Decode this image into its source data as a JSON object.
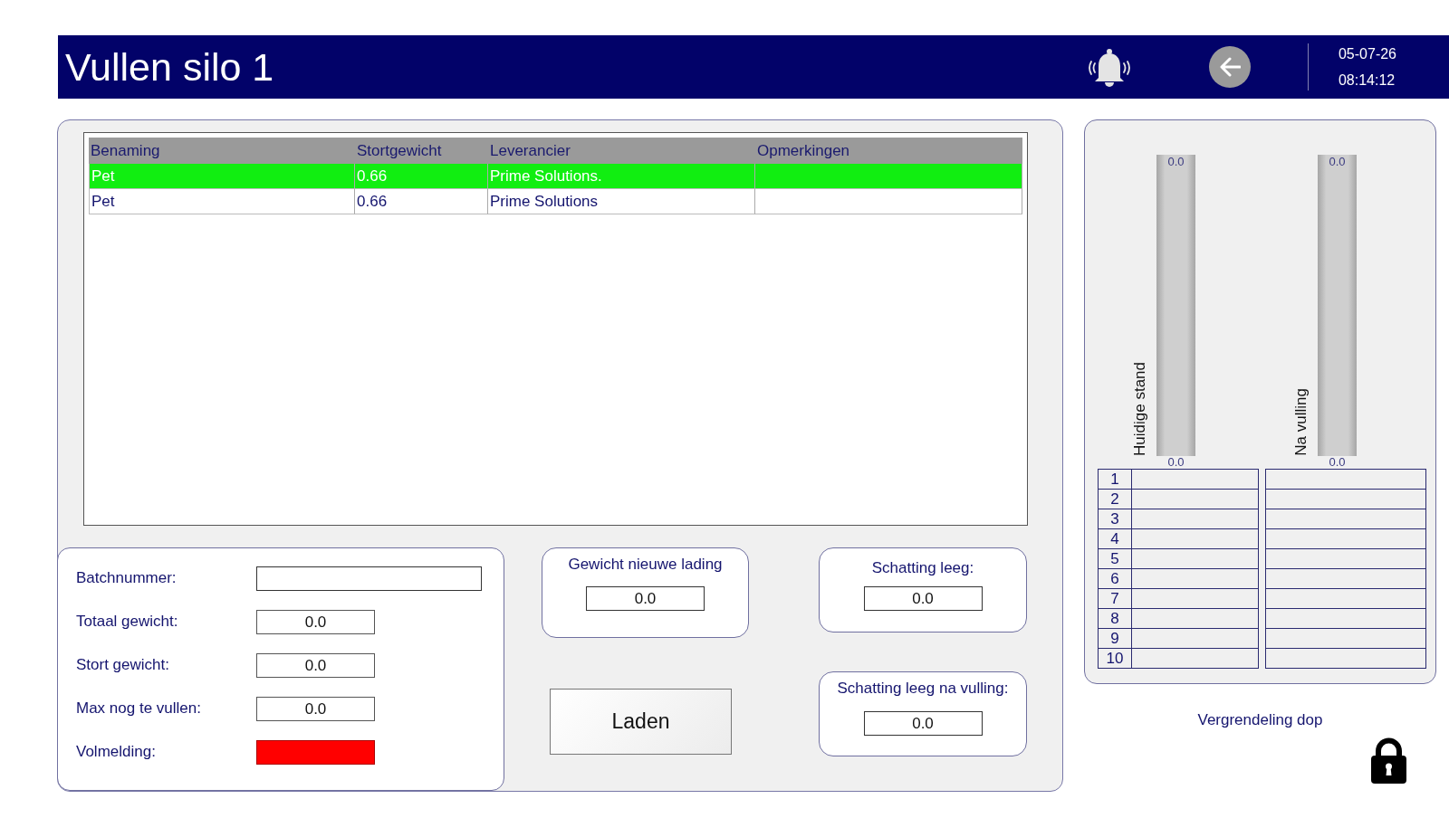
{
  "header": {
    "title": "Vullen silo 1",
    "date": "05-07-26",
    "time": "08:14:12"
  },
  "materials_table": {
    "columns": [
      "Benaming",
      "Stortgewicht",
      "Leverancier",
      "Opmerkingen"
    ],
    "rows": [
      {
        "cells": [
          "Pet",
          "0.66",
          "Prime Solutions."
        ],
        "selected": true
      },
      {
        "cells": [
          "Pet",
          "0.66",
          "Prime Solutions"
        ],
        "selected": false
      }
    ]
  },
  "batch_form": {
    "fields": [
      {
        "kind": "text",
        "label": "Batchnummer:"
      },
      {
        "kind": "number",
        "label": "Totaal gewicht:",
        "value": "0.0"
      },
      {
        "kind": "number",
        "label": "Stort gewicht:",
        "value": "0.0"
      },
      {
        "kind": "number",
        "label": "Max nog te vullen:",
        "value": "0.0"
      },
      {
        "kind": "indicator",
        "label": "Volmelding:",
        "on": true
      }
    ]
  },
  "load_weight": {
    "label": "Gewicht nieuwe lading",
    "value": "0.0"
  },
  "load_button": {
    "label": "Laden"
  },
  "estimates": [
    {
      "label": "Schatting leeg:",
      "value": "0.0"
    },
    {
      "label": "Schatting leeg na vulling:",
      "value": "0.0"
    }
  ],
  "silo_gauges": [
    {
      "label": "Huidige stand",
      "scale_max": "0.0",
      "scale_min": "0.0"
    },
    {
      "label": "Na vulling",
      "scale_max": "0.0",
      "scale_min": "0.0"
    }
  ],
  "silo_table": {
    "row_numbers": [
      "1",
      "2",
      "3",
      "4",
      "5",
      "6",
      "7",
      "8",
      "9",
      "10"
    ]
  },
  "cap_lock": {
    "label": "Vergrendeling dop",
    "locked": true
  }
}
